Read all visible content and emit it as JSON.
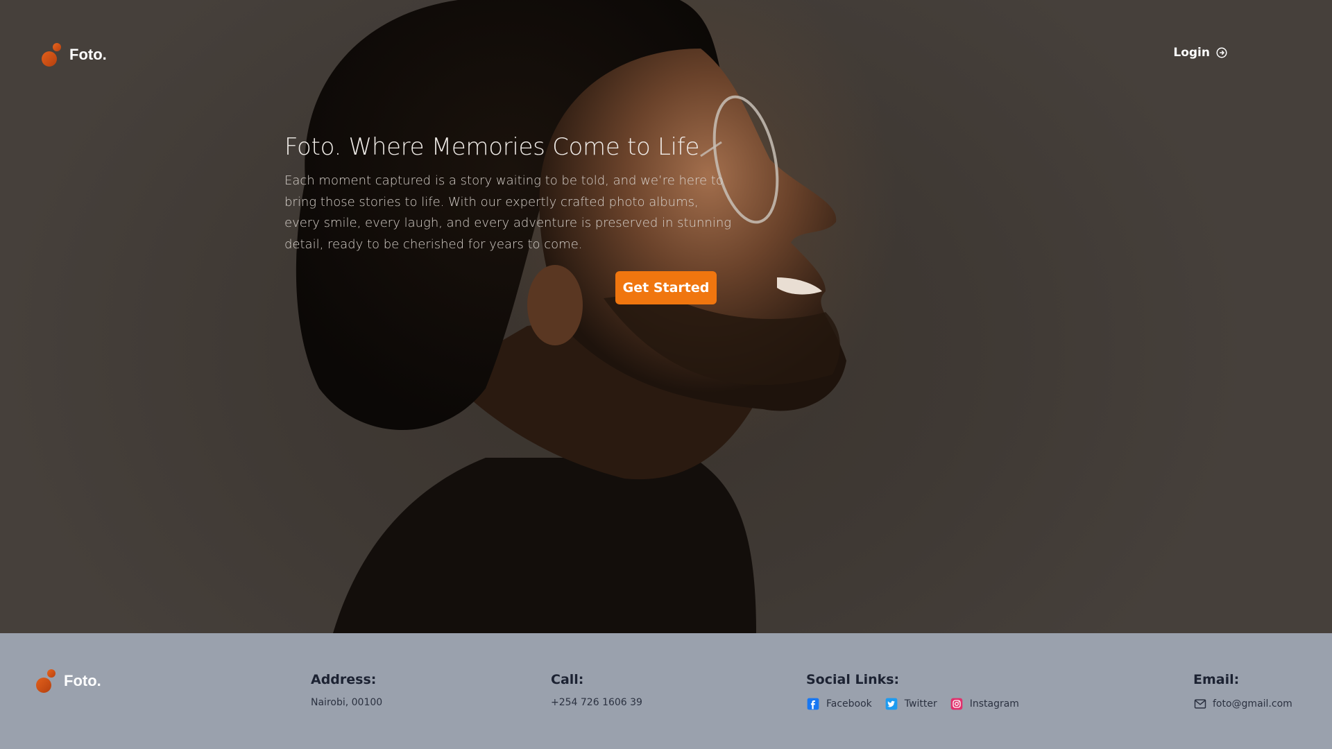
{
  "header": {
    "brand": "Foto.",
    "login_label": "Login"
  },
  "hero": {
    "title": "Foto. Where Memories Come to Life",
    "text": "Each moment captured is a story waiting to be told, and we’re here to bring those stories to life. With our expertly crafted photo albums, every smile, every laugh, and every adventure is preserved in stunning detail, ready to be cherished for years to come.",
    "cta_label": "Get Started"
  },
  "footer": {
    "brand": "Foto.",
    "address": {
      "heading": "Address:",
      "value": "Nairobi, 00100"
    },
    "call": {
      "heading": "Call:",
      "value": "+254 726 1606 39"
    },
    "social": {
      "heading": "Social Links:",
      "links": [
        {
          "label": "Facebook",
          "icon": "facebook-icon",
          "color": "#1877f2"
        },
        {
          "label": "Twitter",
          "icon": "twitter-icon",
          "color": "#1d9bf0"
        },
        {
          "label": "Instagram",
          "icon": "instagram-icon",
          "color": "#e1306c"
        }
      ]
    },
    "email": {
      "heading": "Email:",
      "value": "foto@gmail.com",
      "icon": "mail-icon"
    }
  },
  "colors": {
    "accent": "#f0760f",
    "footer_bg": "#9aa1ad",
    "hero_bg": "#3f3934"
  }
}
